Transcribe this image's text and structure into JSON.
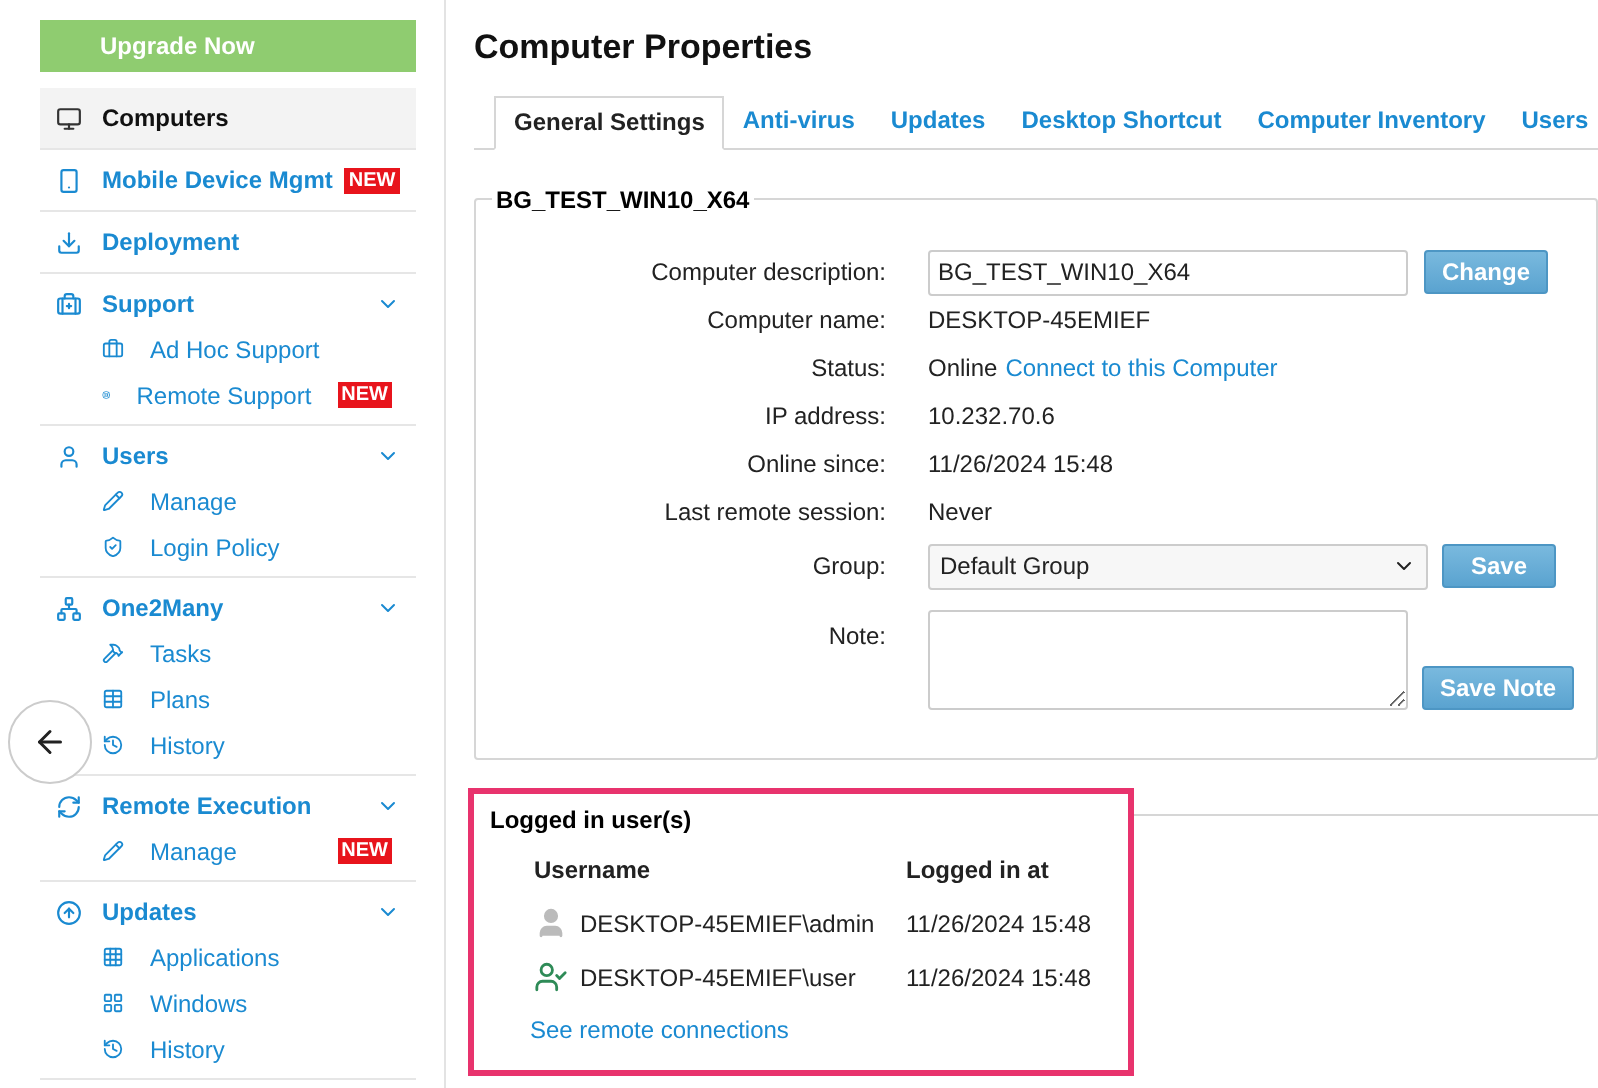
{
  "upgrade_button": "Upgrade Now",
  "sidebar": [
    {
      "label": "Computers",
      "selected": true
    },
    {
      "label": "Mobile Device Mgmt",
      "selected": false,
      "badge": "NEW"
    },
    {
      "label": "Deployment",
      "selected": false
    },
    {
      "label": "Support",
      "selected": false,
      "expanded": true,
      "children": [
        {
          "label": "Ad Hoc Support"
        },
        {
          "label": "Remote Support",
          "badge": "NEW"
        }
      ]
    },
    {
      "label": "Users",
      "selected": false,
      "expanded": true,
      "children": [
        {
          "label": "Manage"
        },
        {
          "label": "Login Policy"
        }
      ]
    },
    {
      "label": "One2Many",
      "selected": false,
      "expanded": true,
      "children": [
        {
          "label": "Tasks"
        },
        {
          "label": "Plans"
        },
        {
          "label": "History"
        }
      ]
    },
    {
      "label": "Remote Execution",
      "selected": false,
      "expanded": true,
      "children": [
        {
          "label": "Manage",
          "badge": "NEW"
        }
      ]
    },
    {
      "label": "Updates",
      "selected": false,
      "expanded": true,
      "children": [
        {
          "label": "Applications"
        },
        {
          "label": "Windows"
        },
        {
          "label": "History"
        }
      ]
    }
  ],
  "page_title": "Computer Properties",
  "tabs": [
    {
      "label": "General Settings",
      "selected": true
    },
    {
      "label": "Anti-virus",
      "selected": false
    },
    {
      "label": "Updates",
      "selected": false
    },
    {
      "label": "Desktop Shortcut",
      "selected": false
    },
    {
      "label": "Computer Inventory",
      "selected": false
    },
    {
      "label": "Users",
      "selected": false
    }
  ],
  "general": {
    "legend": "BG_TEST_WIN10_X64",
    "description": {
      "label": "Computer description:",
      "value": "BG_TEST_WIN10_X64",
      "button": "Change"
    },
    "fields": [
      {
        "label": "Computer name:",
        "value": "DESKTOP-45EMIEF"
      },
      {
        "label": "Status:",
        "value": "Online",
        "link": "Connect to this Computer"
      },
      {
        "label": "IP address:",
        "value": "10.232.70.6"
      },
      {
        "label": "Online since:",
        "value": "11/26/2024 15:48"
      },
      {
        "label": "Last remote session:",
        "value": "Never"
      }
    ],
    "group": {
      "label": "Group:",
      "value": "Default Group",
      "button": "Save"
    },
    "note": {
      "label": "Note:",
      "button": "Save Note"
    }
  },
  "logged_in": {
    "legend": "Logged in user(s)",
    "columns": [
      "Username",
      "Logged in at"
    ],
    "rows": [
      {
        "username": "DESKTOP-45EMIEF\\admin",
        "time": "11/26/2024 15:48",
        "active": false
      },
      {
        "username": "DESKTOP-45EMIEF\\user",
        "time": "11/26/2024 15:48",
        "active": true
      }
    ],
    "link": "See remote connections"
  }
}
